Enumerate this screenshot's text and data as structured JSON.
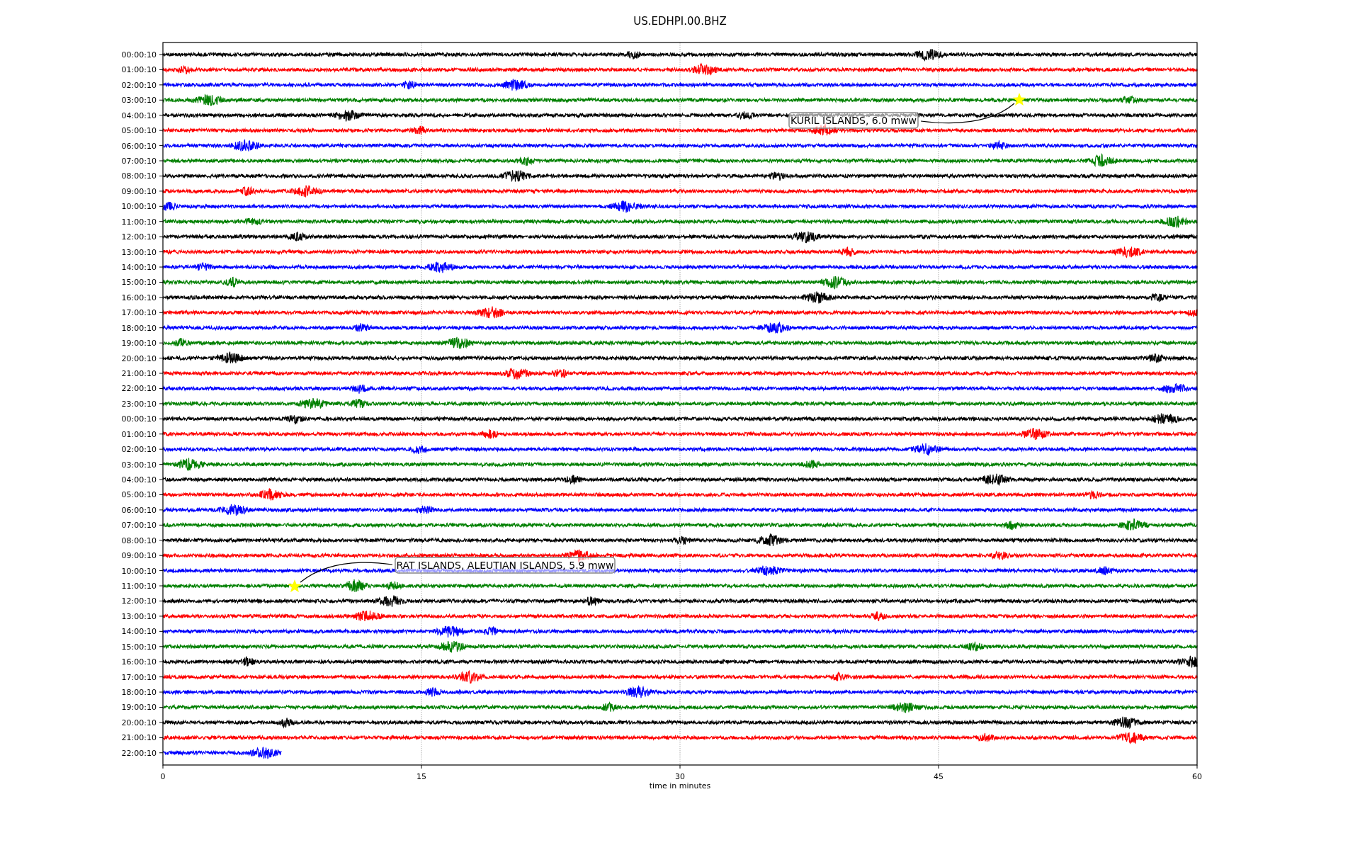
{
  "title": "US.EDHPI.00.BHZ",
  "rows": [
    {
      "label": "00:00:10",
      "color": "#000000",
      "level": 1
    },
    {
      "label": "01:00:10",
      "color": "#ff0000",
      "level": 1
    },
    {
      "label": "02:00:10",
      "color": "#0000ff",
      "level": 1
    },
    {
      "label": "03:00:10",
      "color": "#008000",
      "level": 1
    },
    {
      "label": "04:00:10",
      "color": "#000000",
      "level": 1
    },
    {
      "label": "05:00:10",
      "color": "#ff0000",
      "level": 1
    },
    {
      "label": "06:00:10",
      "color": "#0000ff",
      "level": 1
    },
    {
      "label": "07:00:10",
      "color": "#008000",
      "level": 1
    },
    {
      "label": "08:00:10",
      "color": "#000000",
      "level": 1
    },
    {
      "label": "09:00:10",
      "color": "#ff0000",
      "level": 1
    },
    {
      "label": "10:00:10",
      "color": "#0000ff",
      "level": 1
    },
    {
      "label": "11:00:10",
      "color": "#008000",
      "level": 1
    },
    {
      "label": "12:00:10",
      "color": "#000000",
      "level": 1
    },
    {
      "label": "13:00:10",
      "color": "#ff0000",
      "level": 1
    },
    {
      "label": "14:00:10",
      "color": "#0000ff",
      "level": 1
    },
    {
      "label": "15:00:10",
      "color": "#008000",
      "level": 1
    },
    {
      "label": "16:00:10",
      "color": "#000000",
      "level": 1
    },
    {
      "label": "17:00:10",
      "color": "#ff0000",
      "level": 1
    },
    {
      "label": "18:00:10",
      "color": "#0000ff",
      "level": 1
    },
    {
      "label": "19:00:10",
      "color": "#008000",
      "level": 1
    },
    {
      "label": "20:00:10",
      "color": "#000000",
      "level": 1
    },
    {
      "label": "21:00:10",
      "color": "#ff0000",
      "level": 1
    },
    {
      "label": "22:00:10",
      "color": "#0000ff",
      "level": 1
    },
    {
      "label": "23:00:10",
      "color": "#008000",
      "level": 1
    },
    {
      "label": "00:00:10",
      "color": "#000000",
      "level": 1
    },
    {
      "label": "01:00:10",
      "color": "#ff0000",
      "level": 1
    },
    {
      "label": "02:00:10",
      "color": "#0000ff",
      "level": 1
    },
    {
      "label": "03:00:10",
      "color": "#008000",
      "level": 1
    },
    {
      "label": "04:00:10",
      "color": "#000000",
      "level": 1
    },
    {
      "label": "05:00:10",
      "color": "#ff0000",
      "level": 1
    },
    {
      "label": "06:00:10",
      "color": "#0000ff",
      "level": 1
    },
    {
      "label": "07:00:10",
      "color": "#008000",
      "level": 1
    },
    {
      "label": "08:00:10",
      "color": "#000000",
      "level": 1
    },
    {
      "label": "09:00:10",
      "color": "#ff0000",
      "level": 1
    },
    {
      "label": "10:00:10",
      "color": "#0000ff",
      "level": 1
    },
    {
      "label": "11:00:10",
      "color": "#008000",
      "level": 1
    },
    {
      "label": "12:00:10",
      "color": "#000000",
      "level": 1
    },
    {
      "label": "13:00:10",
      "color": "#ff0000",
      "level": 1
    },
    {
      "label": "14:00:10",
      "color": "#0000ff",
      "level": 1
    },
    {
      "label": "15:00:10",
      "color": "#008000",
      "level": 1
    },
    {
      "label": "16:00:10",
      "color": "#000000",
      "level": 1
    },
    {
      "label": "17:00:10",
      "color": "#ff0000",
      "level": 1
    },
    {
      "label": "18:00:10",
      "color": "#0000ff",
      "level": 1
    },
    {
      "label": "19:00:10",
      "color": "#008000",
      "level": 1
    },
    {
      "label": "20:00:10",
      "color": "#000000",
      "level": 1
    },
    {
      "label": "21:00:10",
      "color": "#ff0000",
      "level": 1
    },
    {
      "label": "22:00:10",
      "color": "#0000ff",
      "level": 0.115
    }
  ],
  "xticks": [
    "0",
    "15",
    "30",
    "45",
    "60"
  ],
  "xlabel": "time in minutes",
  "annotations": [
    {
      "text": "KURIL ISLANDS, 6.0 mww"
    },
    {
      "text": "RAT ISLANDS, ALEUTIAN ISLANDS, 5.9 mww"
    }
  ]
}
